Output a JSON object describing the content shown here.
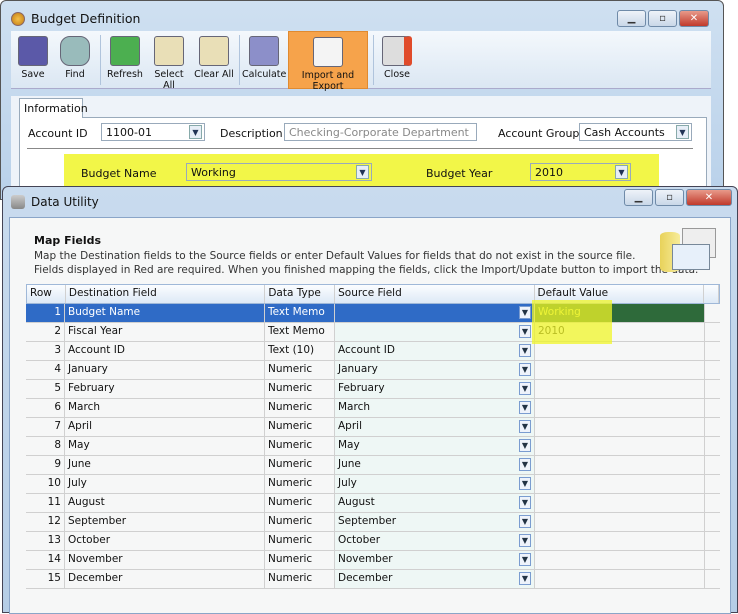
{
  "budget_window": {
    "title": "Budget Definition",
    "toolbar": [
      {
        "label": "Save",
        "icon": "save-icon"
      },
      {
        "label": "Find",
        "icon": "binoculars-icon"
      },
      {
        "label": "Refresh",
        "icon": "refresh-icon"
      },
      {
        "label": "Select All",
        "icon": "select-all-icon"
      },
      {
        "label": "Clear All",
        "icon": "clear-all-icon"
      },
      {
        "label": "Calculate",
        "icon": "calculator-icon"
      },
      {
        "label": "Import and Export",
        "icon": "import-export-icon",
        "active": true
      },
      {
        "label": "Close",
        "icon": "close-window-icon"
      }
    ],
    "tab": "Information",
    "account_id_label": "Account ID",
    "account_id": "1100-01",
    "description_label": "Description",
    "description": "Checking-Corporate Department",
    "account_group_label": "Account Group",
    "account_group": "Cash Accounts",
    "budget_name_label": "Budget Name",
    "budget_name": "Working",
    "budget_year_label": "Budget Year",
    "budget_year": "2010",
    "highlight_color": "#f0f528"
  },
  "data_utility": {
    "title": "Data Utility",
    "heading": "Map Fields",
    "desc1": "Map the Destination fields to the Source fields or enter Default Values for fields that do not exist in the source file.",
    "desc2": "Fields displayed in Red are required.  When you finished mapping the fields, click the Import/Update button to import the data.",
    "columns": [
      "Row",
      "Destination Field",
      "Data Type",
      "Source Field",
      "Default Value"
    ],
    "rows": [
      [
        "1",
        "Budget Name",
        "Text Memo",
        "",
        "Working"
      ],
      [
        "2",
        "Fiscal Year",
        "Text Memo",
        "",
        "2010"
      ],
      [
        "3",
        "Account ID",
        "Text (10)",
        "Account ID",
        ""
      ],
      [
        "4",
        "January",
        "Numeric",
        "January",
        ""
      ],
      [
        "5",
        "February",
        "Numeric",
        "February",
        ""
      ],
      [
        "6",
        "March",
        "Numeric",
        "March",
        ""
      ],
      [
        "7",
        "April",
        "Numeric",
        "April",
        ""
      ],
      [
        "8",
        "May",
        "Numeric",
        "May",
        ""
      ],
      [
        "9",
        "June",
        "Numeric",
        "June",
        ""
      ],
      [
        "10",
        "July",
        "Numeric",
        "July",
        ""
      ],
      [
        "11",
        "August",
        "Numeric",
        "August",
        ""
      ],
      [
        "12",
        "September",
        "Numeric",
        "September",
        ""
      ],
      [
        "13",
        "October",
        "Numeric",
        "October",
        ""
      ],
      [
        "14",
        "November",
        "Numeric",
        "November",
        ""
      ],
      [
        "15",
        "December",
        "Numeric",
        "December",
        ""
      ]
    ],
    "selected_row": 1,
    "selection_color": "#2f6bc6"
  }
}
